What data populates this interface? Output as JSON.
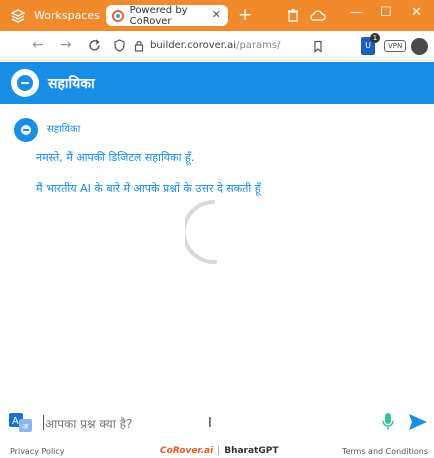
{
  "browser": {
    "workspaces_label": "Workspaces",
    "tab_title": "Powered by CoRover",
    "url_host": "builder.corover.ai",
    "url_path": "/params/",
    "vpn_label": "VPN",
    "extension_badge_count": "1"
  },
  "app": {
    "header_title": "सहायिका"
  },
  "chat": {
    "sender_name": "सहायिका",
    "messages": [
      "नमस्ते, मैं आपकी डिजिटल सहायिका हूँ.",
      "मैं भारतीय AI के बारे में आपके प्रश्नों के उत्तर दे सकती हूँ"
    ]
  },
  "input": {
    "placeholder": "आपका प्रश्न क्या है?"
  },
  "footer": {
    "privacy_label": "Privacy Policy",
    "brand_corover": "CoRover.ai",
    "brand_bharatgpt": "BharatGPT",
    "terms_label": "Terms and Conditions"
  },
  "colors": {
    "browser_bar": "#f08a2c",
    "accent": "#1a8de5"
  }
}
